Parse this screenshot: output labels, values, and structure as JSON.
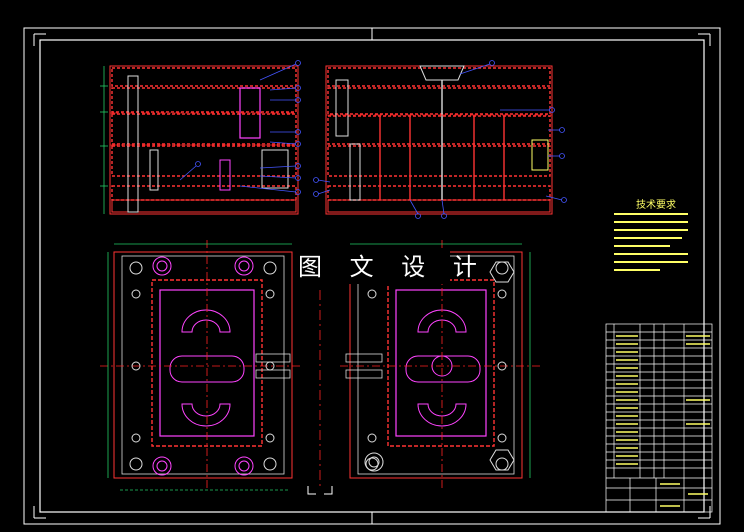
{
  "watermark": {
    "text": "图 文 设 计"
  },
  "technical_notes": {
    "title": "技术要求"
  },
  "colors": {
    "background": "#000000",
    "frame": "#ffffff",
    "plate": "#ff3333",
    "cavity": "#ff44ff",
    "center_line": "#ff2222",
    "dimension": "#22cc66",
    "leader": "#4455ff",
    "text": "#ffff66",
    "table": "#ffffff"
  }
}
